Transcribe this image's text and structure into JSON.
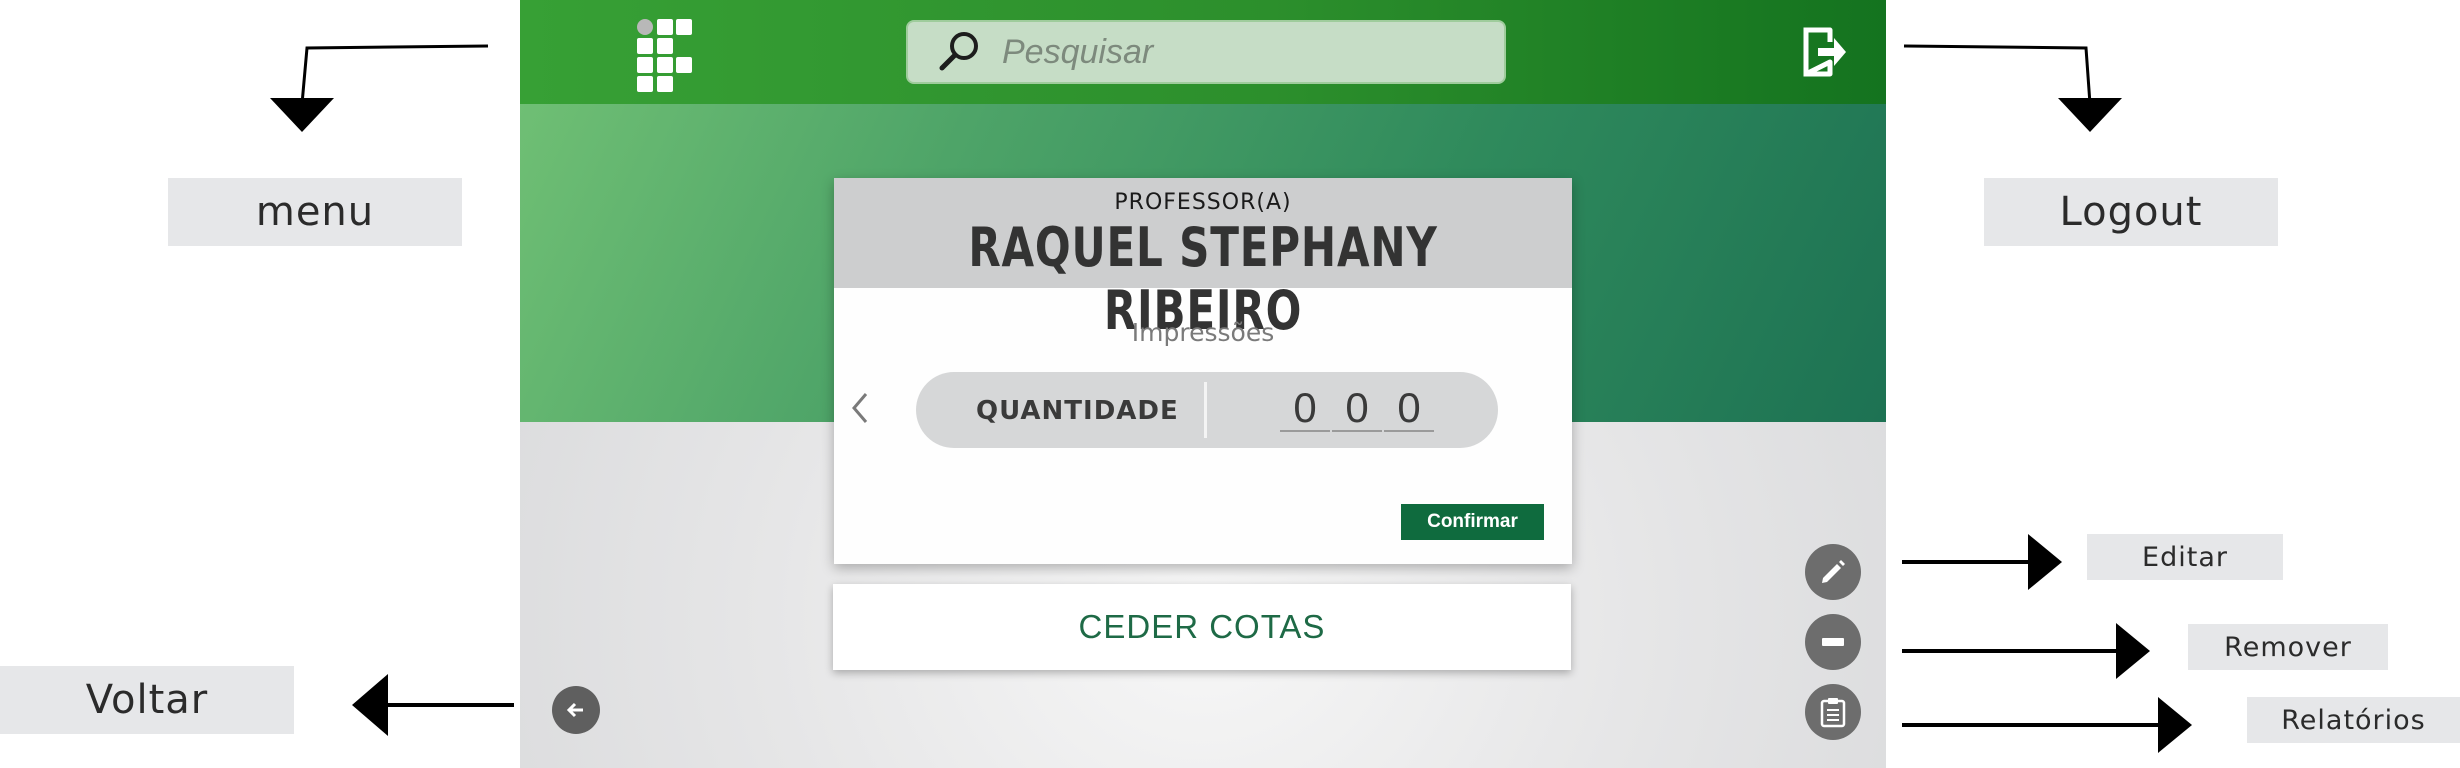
{
  "annotations": {
    "menu": "menu",
    "logout": "Logout",
    "voltar": "Voltar",
    "editar": "Editar",
    "remover": "Remover",
    "relatorios": "Relatórios"
  },
  "topbar": {
    "search_placeholder": "Pesquisar",
    "logo_icon": "institution-logo-icon",
    "logout_icon": "logout-icon"
  },
  "card": {
    "role": "PROFESSOR(A)",
    "name": "RAQUEL STEPHANY RIBEIRO",
    "section_title": "Impressões",
    "quantity_label": "QUANTIDADE",
    "digits": [
      "0",
      "0",
      "0"
    ],
    "confirm_label": "Confirmar"
  },
  "ceder_label": "CEDER COTAS",
  "colors": {
    "topbar_green": "#2c8f2c",
    "confirm_green": "#0f6b3e",
    "ceder_text": "#1e6a46",
    "fab_gray": "#6d6d6d"
  }
}
